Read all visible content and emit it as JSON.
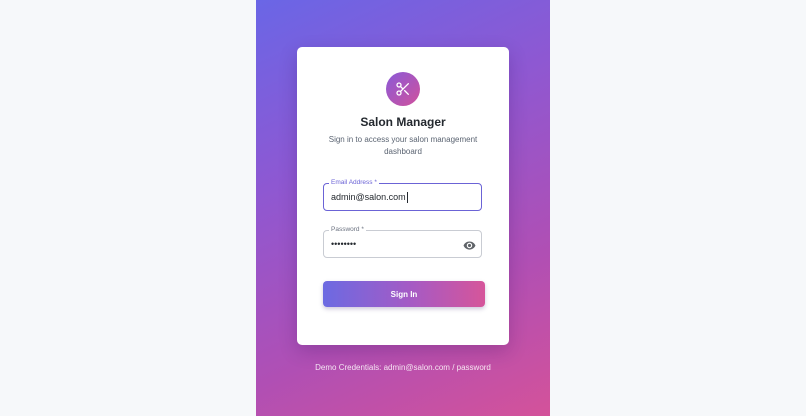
{
  "app": {
    "title": "Salon Manager",
    "subtitle": "Sign in to access your salon management dashboard",
    "logo_icon": "scissors-icon"
  },
  "form": {
    "email": {
      "label": "Email Address *",
      "value": "admin@salon.com",
      "focused": true
    },
    "password": {
      "label": "Password *",
      "value_masked": "••••••••",
      "toggle_icon": "eye-icon"
    },
    "submit_label": "Sign In"
  },
  "footer": {
    "demo_credentials": "Demo Credentials: admin@salon.com / password"
  },
  "colors": {
    "page_background": "#f6f8fa",
    "gradient_start": "#6a66e6",
    "gradient_end": "#d4529a",
    "focus_border": "#6b63d6",
    "card": "#ffffff"
  }
}
